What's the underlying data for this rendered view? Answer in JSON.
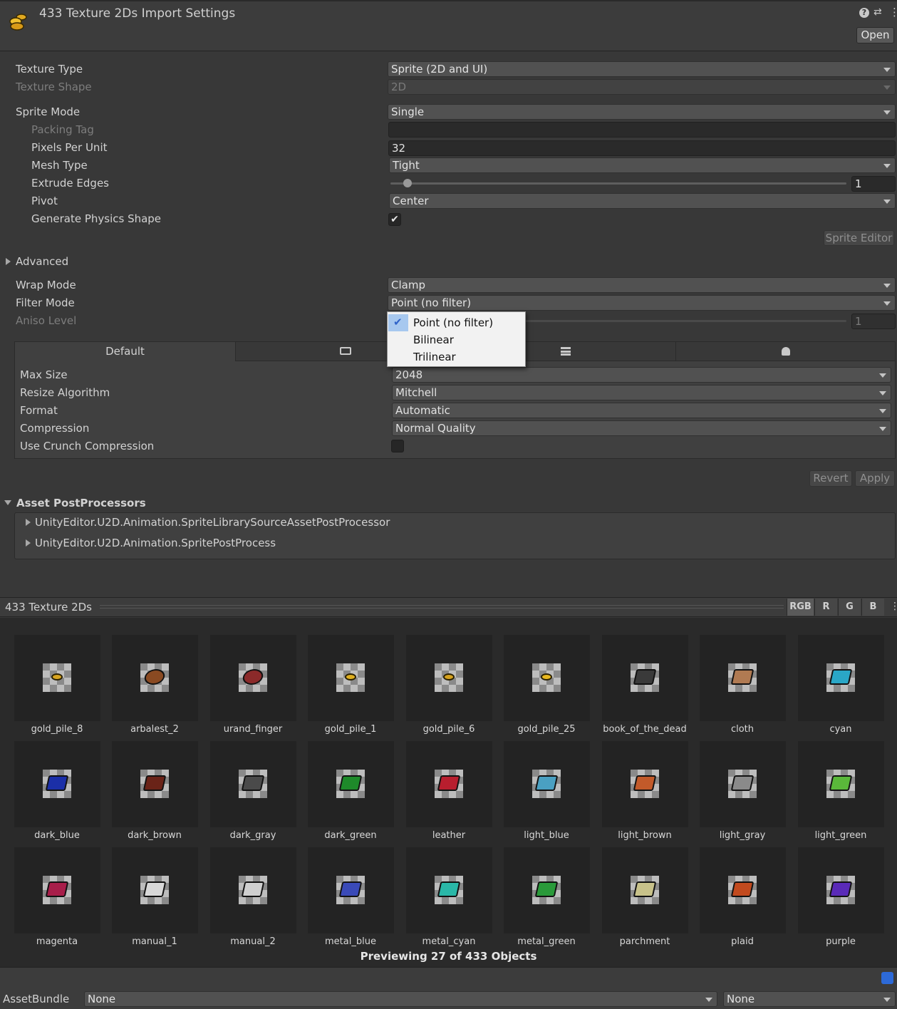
{
  "header": {
    "title": "433 Texture 2Ds Import Settings",
    "open_label": "Open"
  },
  "settings": {
    "texture_type_label": "Texture Type",
    "texture_type_value": "Sprite (2D and UI)",
    "texture_shape_label": "Texture Shape",
    "texture_shape_value": "2D",
    "sprite_mode_label": "Sprite Mode",
    "sprite_mode_value": "Single",
    "packing_tag_label": "Packing Tag",
    "packing_tag_value": "",
    "ppu_label": "Pixels Per Unit",
    "ppu_value": "32",
    "mesh_type_label": "Mesh Type",
    "mesh_type_value": "Tight",
    "extrude_label": "Extrude Edges",
    "extrude_value": "1",
    "pivot_label": "Pivot",
    "pivot_value": "Center",
    "physics_label": "Generate Physics Shape",
    "physics_checked": "✔",
    "sprite_editor_label": "Sprite Editor",
    "advanced_label": "Advanced",
    "wrap_label": "Wrap Mode",
    "wrap_value": "Clamp",
    "filter_label": "Filter Mode",
    "filter_value": "Point (no filter)",
    "aniso_label": "Aniso Level",
    "aniso_value": "1"
  },
  "filter_menu": {
    "items": [
      "Point (no filter)",
      "Bilinear",
      "Trilinear"
    ],
    "selected": "Point (no filter)",
    "check": "✔"
  },
  "platform": {
    "default_tab": "Default",
    "max_size_label": "Max Size",
    "max_size_value": "2048",
    "resize_label": "Resize Algorithm",
    "resize_value": "Mitchell",
    "format_label": "Format",
    "format_value": "Automatic",
    "compression_label": "Compression",
    "compression_value": "Normal Quality",
    "crunch_label": "Use Crunch Compression"
  },
  "actions": {
    "revert": "Revert",
    "apply": "Apply"
  },
  "postprocessors": {
    "title": "Asset PostProcessors",
    "items": [
      "UnityEditor.U2D.Animation.SpriteLibrarySourceAssetPostProcessor",
      "UnityEditor.U2D.Animation.SpritePostProcess"
    ]
  },
  "preview": {
    "title": "433 Texture 2Ds",
    "channels": [
      "RGB",
      "R",
      "G",
      "B"
    ],
    "status": "Previewing 27 of 433 Objects",
    "items": [
      {
        "name": "gold_pile_8",
        "kind": "coin",
        "color": "#d8a521"
      },
      {
        "name": "arbalest_2",
        "kind": "weapon",
        "color": "#8a4a22"
      },
      {
        "name": "urand_finger",
        "kind": "ring",
        "color": "#8b2a2a"
      },
      {
        "name": "gold_pile_1",
        "kind": "coin",
        "color": "#e0b020"
      },
      {
        "name": "gold_pile_6",
        "kind": "coin",
        "color": "#d6a21e"
      },
      {
        "name": "gold_pile_25",
        "kind": "coin",
        "color": "#e8b81f"
      },
      {
        "name": "book_of_the_dead",
        "kind": "book",
        "color": "#3a3a3a"
      },
      {
        "name": "cloth",
        "kind": "book",
        "color": "#b07a52"
      },
      {
        "name": "cyan",
        "kind": "book",
        "color": "#2aa7c7"
      },
      {
        "name": "dark_blue",
        "kind": "book",
        "color": "#1b2fa8"
      },
      {
        "name": "dark_brown",
        "kind": "book",
        "color": "#6a2318"
      },
      {
        "name": "dark_gray",
        "kind": "book",
        "color": "#4a4a4a"
      },
      {
        "name": "dark_green",
        "kind": "book",
        "color": "#1e8a2a"
      },
      {
        "name": "leather",
        "kind": "book",
        "color": "#b81e2e"
      },
      {
        "name": "light_blue",
        "kind": "book",
        "color": "#4aa0c2"
      },
      {
        "name": "light_brown",
        "kind": "book",
        "color": "#c25a2a"
      },
      {
        "name": "light_gray",
        "kind": "book",
        "color": "#8a8a8a"
      },
      {
        "name": "light_green",
        "kind": "book",
        "color": "#5ab83a"
      },
      {
        "name": "magenta",
        "kind": "book",
        "color": "#a81e4a"
      },
      {
        "name": "manual_1",
        "kind": "book",
        "color": "#d8d8d8"
      },
      {
        "name": "manual_2",
        "kind": "book",
        "color": "#cfcfcf"
      },
      {
        "name": "metal_blue",
        "kind": "book",
        "color": "#3a4ab8"
      },
      {
        "name": "metal_cyan",
        "kind": "book",
        "color": "#2ab8a8"
      },
      {
        "name": "metal_green",
        "kind": "book",
        "color": "#2a9a3a"
      },
      {
        "name": "parchment",
        "kind": "book",
        "color": "#c8c28a"
      },
      {
        "name": "plaid",
        "kind": "book",
        "color": "#c24a1e"
      },
      {
        "name": "purple",
        "kind": "book",
        "color": "#5a2ab8"
      }
    ]
  },
  "footer": {
    "assetbundle_label": "AssetBundle",
    "bundle_value": "None",
    "variant_value": "None"
  }
}
